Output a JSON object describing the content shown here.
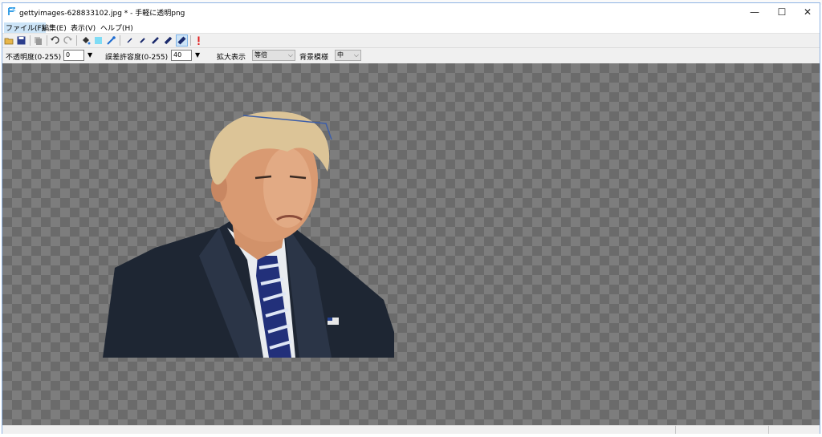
{
  "window": {
    "title": "gettyimages-628833102.jpg * - 手軽に透明png",
    "minimize": "—",
    "maximize": "☐",
    "close": "✕"
  },
  "menu": [
    {
      "label": "ファイル(F)"
    },
    {
      "label": "編集(E)"
    },
    {
      "label": "表示(V)"
    },
    {
      "label": "ヘルプ(H)"
    }
  ],
  "toolbar": {
    "icons": [
      "open-folder-icon",
      "save-icon",
      "copy-icon",
      "undo-icon",
      "redo-icon",
      "fill-bucket-icon",
      "rectangle-icon",
      "eyedropper-icon",
      "pen-size-1-icon",
      "pen-size-2-icon",
      "pen-size-3-icon",
      "pen-size-4-icon",
      "pen-size-5-icon",
      "alert-icon"
    ]
  },
  "options": {
    "opacity_label": "不透明度(0-255)",
    "opacity_value": "0",
    "tolerance_label": "誤差許容度(0-255)",
    "tolerance_value": "40",
    "zoom_label": "拡大表示",
    "zoom_value": "等倍",
    "bg_pattern_label": "背景模様",
    "bg_pattern_value": "中",
    "arrow": "▼",
    "caret": "⌵"
  },
  "colors": {
    "accent": "#8db2e3",
    "checker_dark": "#6b6b6b",
    "checker_light": "#7d7d7d"
  }
}
